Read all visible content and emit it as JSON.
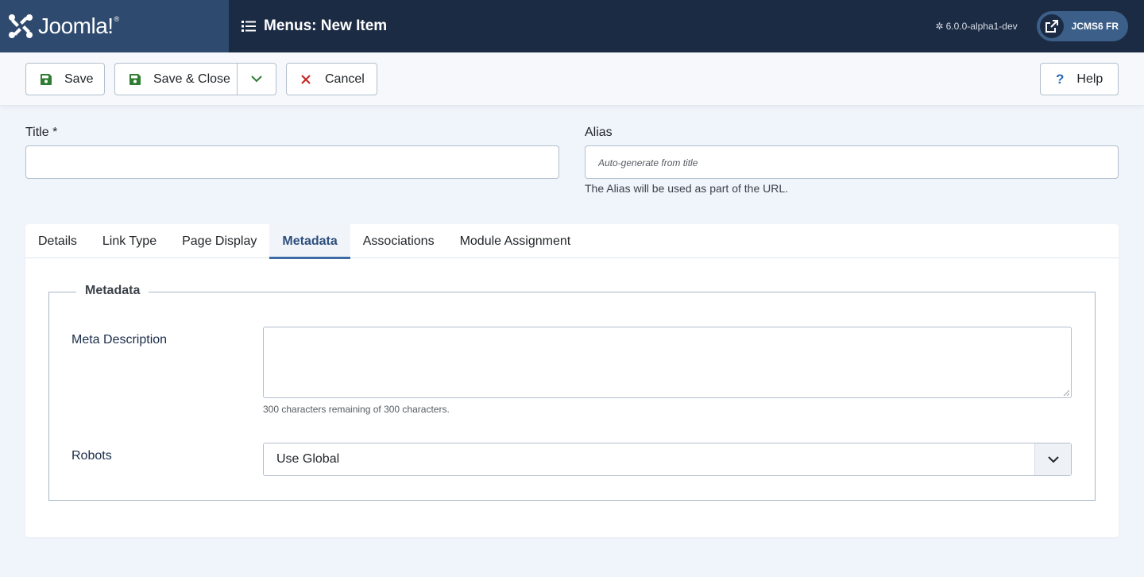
{
  "header": {
    "brand_name": "Joomla!",
    "page_title": "Menus: New Item",
    "version": "6.0.0-alpha1-dev",
    "site_button_label": "JCMS6 FR"
  },
  "toolbar": {
    "save_label": "Save",
    "save_close_label": "Save & Close",
    "cancel_label": "Cancel",
    "help_label": "Help"
  },
  "form": {
    "title_label": "Title *",
    "title_value": "",
    "alias_label": "Alias",
    "alias_placeholder": "Auto-generate from title",
    "alias_hint": "The Alias will be used as part of the URL."
  },
  "tabs": [
    {
      "label": "Details",
      "active": false
    },
    {
      "label": "Link Type",
      "active": false
    },
    {
      "label": "Page Display",
      "active": false
    },
    {
      "label": "Metadata",
      "active": true
    },
    {
      "label": "Associations",
      "active": false
    },
    {
      "label": "Module Assignment",
      "active": false
    }
  ],
  "metadata": {
    "legend": "Metadata",
    "meta_description_label": "Meta Description",
    "meta_description_value": "",
    "char_counter": "300 characters remaining of 300 characters.",
    "robots_label": "Robots",
    "robots_value": "Use Global"
  },
  "colors": {
    "header_bg": "#1c2b44",
    "brand_bg": "#2e4a6e",
    "accent": "#2d4f7c",
    "save_icon": "#2f7d32",
    "cancel_icon": "#c52827"
  },
  "icons": {
    "brand": "joomla-logo-icon",
    "heading": "list-icon",
    "site": "external-link-icon",
    "save": "floppy-disk-icon",
    "dropdown": "chevron-down-icon",
    "cancel": "close-icon",
    "help": "question-icon"
  }
}
